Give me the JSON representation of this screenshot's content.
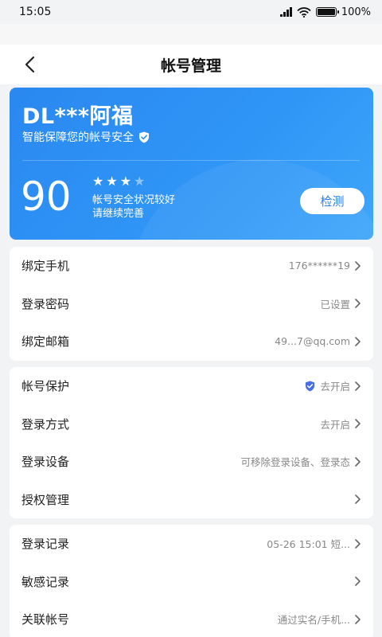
{
  "status_bar": {
    "time": "15:05",
    "battery": "100%"
  },
  "nav": {
    "title": "帐号管理"
  },
  "hero": {
    "name": "DL***阿福",
    "subtitle": "智能保障您的帐号安全",
    "score": "90",
    "stars_on": 3,
    "stars_total": 4,
    "status_line1": "帐号安全状况较好",
    "status_line2": "请继续完善",
    "detect_label": "检测"
  },
  "groups": [
    {
      "items": [
        {
          "label": "绑定手机",
          "value": "176******19"
        },
        {
          "label": "登录密码",
          "value": "已设置"
        },
        {
          "label": "绑定邮箱",
          "value": "49...7@qq.com"
        }
      ]
    },
    {
      "items": [
        {
          "label": "帐号保护",
          "value": "去开启",
          "shield": true
        },
        {
          "label": "登录方式",
          "value": "去开启"
        },
        {
          "label": "登录设备",
          "value": "可移除登录设备、登录态"
        },
        {
          "label": "授权管理",
          "value": ""
        }
      ]
    },
    {
      "items": [
        {
          "label": "登录记录",
          "value": "05-26 15:01 短..."
        },
        {
          "label": "敏感记录",
          "value": ""
        },
        {
          "label": "关联帐号",
          "value": "通过实名/手机..."
        }
      ]
    }
  ],
  "colors": {
    "accent": "#2a88f0",
    "shield": "#4a6ee0",
    "background": "#f2f3f5"
  }
}
